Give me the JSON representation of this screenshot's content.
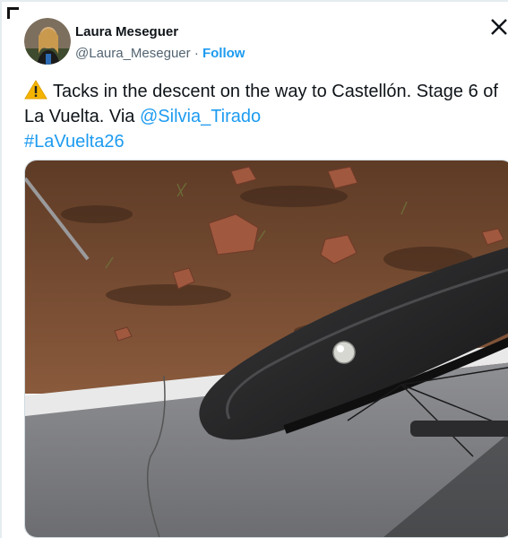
{
  "author": {
    "name": "Laura Meseguer",
    "handle": "@Laura_Meseguer",
    "separator": "·",
    "follow_label": "Follow",
    "avatar_icon": "avatar-photo"
  },
  "close_icon": "close-icon",
  "tweet": {
    "text_main": "Tacks in the descent on the way to Castellón. Stage 6 of La Vuelta. Via ",
    "mention": "@Silvia_Tirado",
    "hashtag": "#LaVuelta26",
    "warning_icon": "warning-icon"
  },
  "colors": {
    "link": "#1d9bf0",
    "text": "#0f1419",
    "muted": "#536471"
  },
  "media": {
    "icon": "photo-bike-wheel-tacks"
  }
}
